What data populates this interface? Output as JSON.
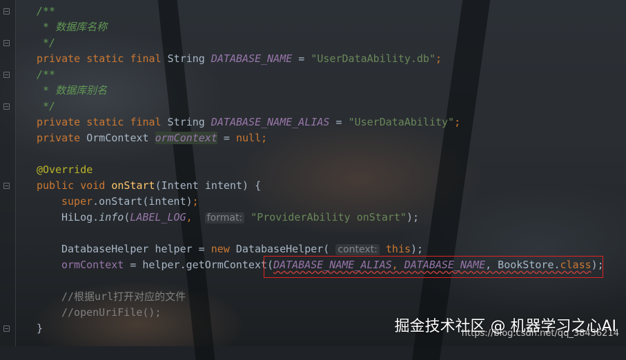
{
  "editor": {
    "lines": [
      {
        "t": "/**"
      },
      {
        "t": " * 数据库名称"
      },
      {
        "t": " */"
      },
      {
        "kw1": "private static final",
        "type": " String ",
        "const": "DATABASE_NAME",
        "op": " = ",
        "str": "\"UserDataAbility.db\"",
        "end": ";"
      },
      {
        "t": "/**"
      },
      {
        "t": " * 数据库别名"
      },
      {
        "t": " */"
      },
      {
        "kw1": "private static final",
        "type": " String ",
        "const": "DATABASE_NAME_ALIAS",
        "op": " = ",
        "str": "\"UserDataAbility\"",
        "end": ";"
      },
      {
        "kw1": "private",
        "type": " OrmContext ",
        "field": "ormContext",
        "op": " = ",
        "kw2": "null",
        "end": ";"
      },
      {
        "t": ""
      },
      {
        "t": "@Override"
      },
      {
        "kw1": "public void",
        "fn": "onStart",
        "rest": "(Intent intent) {"
      },
      {
        "kw1": "super",
        "rest": ".onStart(intent)",
        "end": ";"
      },
      {
        "pre": "HiLog.",
        "method": "info",
        "open": "(",
        "const": "LABEL_LOG",
        "comma": ",",
        "hint": "format:",
        "str": "\"ProviderAbility onStart\"",
        "end": ");"
      },
      {
        "t": ""
      },
      {
        "pre": "DatabaseHelper helper = ",
        "kw1": "new",
        "rest": " DatabaseHelper(",
        "hint": "context:",
        "kw2": "this",
        "end": ");"
      },
      {
        "field": "ormContext",
        "rest": " = helper.getOrmContext(",
        "c1": "DATABASE_NAME_ALIAS",
        "sep": ", ",
        "c2": "DATABASE_NAME",
        "sep2": ", BookStore.",
        "kw1": "class",
        "end": ");"
      },
      {
        "t": ""
      },
      {
        "t": "//根据url打开对应的文件"
      },
      {
        "t": "//openUriFile();"
      },
      {
        "t": "}"
      }
    ]
  },
  "watermark": {
    "text": "掘金技术社区 @ 机器学习之心AI",
    "url": "https://blog.csdn.net/qq_38436214"
  }
}
